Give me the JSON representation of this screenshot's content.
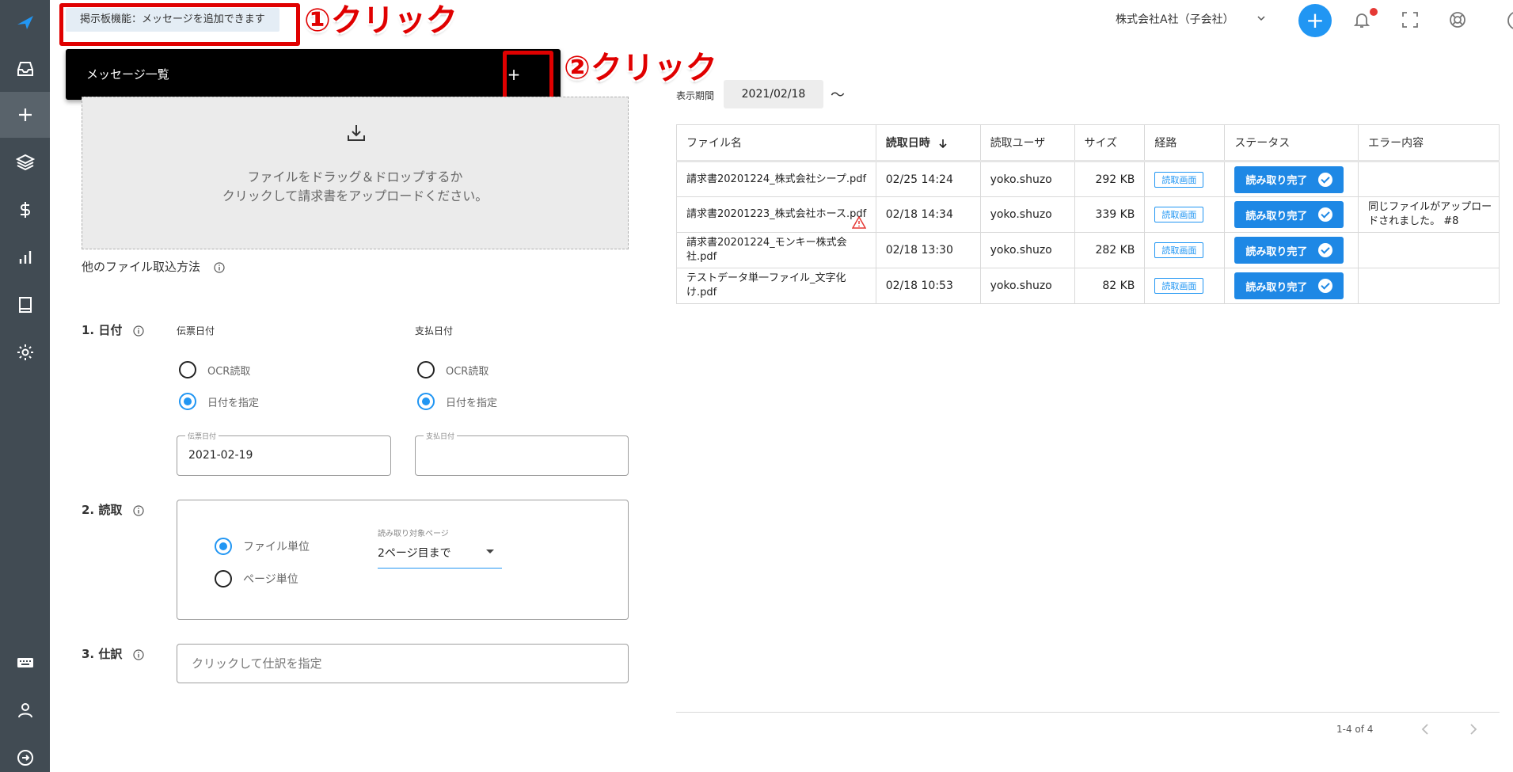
{
  "topbar": {
    "board_button": "掲示板機能：メッセージを追加できます",
    "company": "株式会社A社（子会社）"
  },
  "annotations": {
    "step1": "①クリック",
    "step2": "②クリック"
  },
  "message_panel": {
    "title": "メッセージ一覧",
    "add_label": "+"
  },
  "dropzone": {
    "line1": "ファイルをドラッグ＆ドロップするか",
    "line2": "クリックして請求書をアップロードください。"
  },
  "other_methods": "他のファイル取込方法",
  "date_section": {
    "label": "1. 日付",
    "slip": {
      "title": "伝票日付",
      "opt_ocr": "OCR読取",
      "opt_specify": "日付を指定",
      "field_label": "伝票日付",
      "field_value": "2021-02-19"
    },
    "payment": {
      "title": "支払日付",
      "opt_ocr": "OCR読取",
      "opt_specify": "日付を指定",
      "field_label": "支払日付",
      "field_value": ""
    }
  },
  "read_section": {
    "label": "2. 読取",
    "opt_file": "ファイル単位",
    "opt_page": "ページ単位",
    "select_label": "読み取り対象ページ",
    "select_value": "2ページ目まで"
  },
  "journal_section": {
    "label": "3. 仕訳",
    "placeholder": "クリックして仕訳を指定"
  },
  "period": {
    "label": "表示期間",
    "value": "2021/02/18",
    "tilde": "〜"
  },
  "table": {
    "headers": [
      "ファイル名",
      "読取日時",
      "読取ユーザ",
      "サイズ",
      "経路",
      "ステータス",
      "エラー内容"
    ],
    "rows": [
      {
        "file": "請求書20201224_株式会社シープ.pdf",
        "date": "02/25  14:24",
        "user": "yoko.shuzo",
        "size": "292 KB",
        "route": "読取画面",
        "status": "読み取り完了",
        "error": ""
      },
      {
        "file": "請求書20201223_株式会社ホース.pdf",
        "date": "02/18  14:34",
        "user": "yoko.shuzo",
        "size": "339 KB",
        "route": "読取画面",
        "status": "読み取り完了",
        "error": "同じファイルがアップロードされました。 #8"
      },
      {
        "file": "請求書20201224_モンキー株式会社.pdf",
        "date": "02/18  13:30",
        "user": "yoko.shuzo",
        "size": "282 KB",
        "route": "読取画面",
        "status": "読み取り完了",
        "error": ""
      },
      {
        "file": "テストデータ単一ファイル_文字化け.pdf",
        "date": "02/18  10:53",
        "user": "yoko.shuzo",
        "size": "82 KB",
        "route": "読取画面",
        "status": "読み取り完了",
        "error": ""
      }
    ]
  },
  "pagination": "1-4 of 4",
  "colors": {
    "sidebar": "#414b53",
    "accent": "#2196f3",
    "annotation": "#e00000"
  }
}
